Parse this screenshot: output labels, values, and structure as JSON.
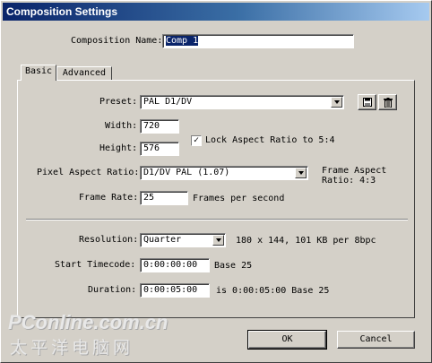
{
  "window": {
    "title": "Composition Settings"
  },
  "comp_name": {
    "label": "Composition Name:",
    "value": "Comp 1"
  },
  "tabs": [
    {
      "label": "Basic"
    },
    {
      "label": "Advanced"
    }
  ],
  "preset": {
    "label": "Preset:",
    "value": "PAL D1/DV",
    "save_icon": "floppy-disk-icon",
    "delete_icon": "trash-icon"
  },
  "width": {
    "label": "Width:",
    "value": "720"
  },
  "height": {
    "label": "Height:",
    "value": "576"
  },
  "lock_aspect": {
    "label": "Lock Aspect Ratio to 5:4",
    "checked": true
  },
  "pixel_aspect": {
    "label": "Pixel Aspect Ratio:",
    "value": "D1/DV PAL (1.07)"
  },
  "frame_aspect": {
    "label": "Frame Aspect",
    "value": "Ratio: 4:3"
  },
  "frame_rate": {
    "label": "Frame Rate:",
    "value": "25",
    "units": "Frames per second"
  },
  "resolution": {
    "label": "Resolution:",
    "value": "Quarter",
    "info": "180 x 144, 101 KB per 8bpc"
  },
  "start_timecode": {
    "label": "Start Timecode:",
    "value": "0:00:00:00",
    "base": "Base 25"
  },
  "duration": {
    "label": "Duration:",
    "value": "0:00:05:00",
    "info": "is 0:00:05:00  Base 25"
  },
  "buttons": {
    "ok": "OK",
    "cancel": "Cancel"
  },
  "watermark": {
    "line1": "PConline.com.cn",
    "line2": "太平洋电脑网"
  }
}
